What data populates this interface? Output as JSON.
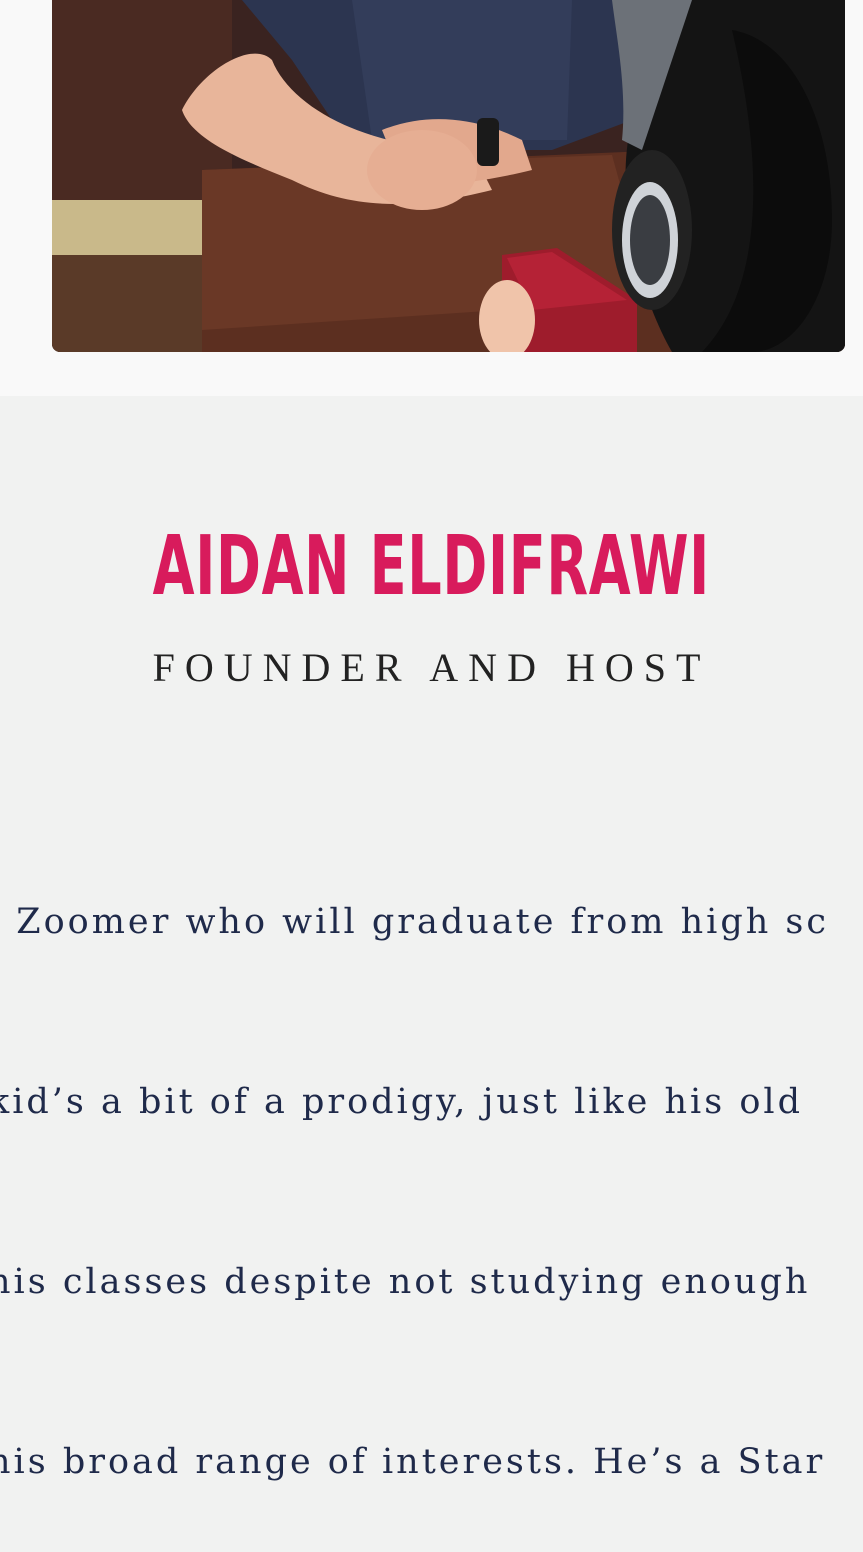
{
  "profile": {
    "name": "AIDAN ELDIFRAWI",
    "role": "FOUNDER AND HOST",
    "bio_lines": [
      ". Zoomer who will graduate from high sc",
      "kid’s a bit of a prodigy, just like his old",
      "his classes despite not studying enough",
      "his broad range of interests. He’s a Star"
    ]
  },
  "colors": {
    "name_accent": "#d81b5c",
    "page_background": "#f1f2f1",
    "bio_text": "#1f2a4a"
  }
}
